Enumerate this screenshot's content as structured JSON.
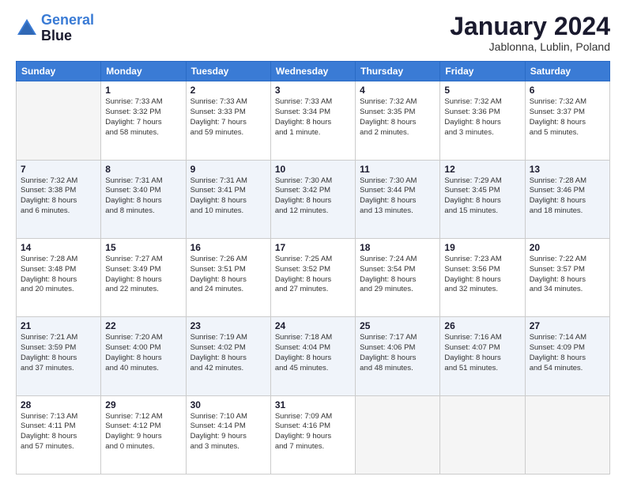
{
  "header": {
    "logo_line1": "General",
    "logo_line2": "Blue",
    "month": "January 2024",
    "location": "Jablonna, Lublin, Poland"
  },
  "weekdays": [
    "Sunday",
    "Monday",
    "Tuesday",
    "Wednesday",
    "Thursday",
    "Friday",
    "Saturday"
  ],
  "weeks": [
    [
      {
        "day": "",
        "info": ""
      },
      {
        "day": "1",
        "info": "Sunrise: 7:33 AM\nSunset: 3:32 PM\nDaylight: 7 hours\nand 58 minutes."
      },
      {
        "day": "2",
        "info": "Sunrise: 7:33 AM\nSunset: 3:33 PM\nDaylight: 7 hours\nand 59 minutes."
      },
      {
        "day": "3",
        "info": "Sunrise: 7:33 AM\nSunset: 3:34 PM\nDaylight: 8 hours\nand 1 minute."
      },
      {
        "day": "4",
        "info": "Sunrise: 7:32 AM\nSunset: 3:35 PM\nDaylight: 8 hours\nand 2 minutes."
      },
      {
        "day": "5",
        "info": "Sunrise: 7:32 AM\nSunset: 3:36 PM\nDaylight: 8 hours\nand 3 minutes."
      },
      {
        "day": "6",
        "info": "Sunrise: 7:32 AM\nSunset: 3:37 PM\nDaylight: 8 hours\nand 5 minutes."
      }
    ],
    [
      {
        "day": "7",
        "info": "Sunrise: 7:32 AM\nSunset: 3:38 PM\nDaylight: 8 hours\nand 6 minutes."
      },
      {
        "day": "8",
        "info": "Sunrise: 7:31 AM\nSunset: 3:40 PM\nDaylight: 8 hours\nand 8 minutes."
      },
      {
        "day": "9",
        "info": "Sunrise: 7:31 AM\nSunset: 3:41 PM\nDaylight: 8 hours\nand 10 minutes."
      },
      {
        "day": "10",
        "info": "Sunrise: 7:30 AM\nSunset: 3:42 PM\nDaylight: 8 hours\nand 12 minutes."
      },
      {
        "day": "11",
        "info": "Sunrise: 7:30 AM\nSunset: 3:44 PM\nDaylight: 8 hours\nand 13 minutes."
      },
      {
        "day": "12",
        "info": "Sunrise: 7:29 AM\nSunset: 3:45 PM\nDaylight: 8 hours\nand 15 minutes."
      },
      {
        "day": "13",
        "info": "Sunrise: 7:28 AM\nSunset: 3:46 PM\nDaylight: 8 hours\nand 18 minutes."
      }
    ],
    [
      {
        "day": "14",
        "info": "Sunrise: 7:28 AM\nSunset: 3:48 PM\nDaylight: 8 hours\nand 20 minutes."
      },
      {
        "day": "15",
        "info": "Sunrise: 7:27 AM\nSunset: 3:49 PM\nDaylight: 8 hours\nand 22 minutes."
      },
      {
        "day": "16",
        "info": "Sunrise: 7:26 AM\nSunset: 3:51 PM\nDaylight: 8 hours\nand 24 minutes."
      },
      {
        "day": "17",
        "info": "Sunrise: 7:25 AM\nSunset: 3:52 PM\nDaylight: 8 hours\nand 27 minutes."
      },
      {
        "day": "18",
        "info": "Sunrise: 7:24 AM\nSunset: 3:54 PM\nDaylight: 8 hours\nand 29 minutes."
      },
      {
        "day": "19",
        "info": "Sunrise: 7:23 AM\nSunset: 3:56 PM\nDaylight: 8 hours\nand 32 minutes."
      },
      {
        "day": "20",
        "info": "Sunrise: 7:22 AM\nSunset: 3:57 PM\nDaylight: 8 hours\nand 34 minutes."
      }
    ],
    [
      {
        "day": "21",
        "info": "Sunrise: 7:21 AM\nSunset: 3:59 PM\nDaylight: 8 hours\nand 37 minutes."
      },
      {
        "day": "22",
        "info": "Sunrise: 7:20 AM\nSunset: 4:00 PM\nDaylight: 8 hours\nand 40 minutes."
      },
      {
        "day": "23",
        "info": "Sunrise: 7:19 AM\nSunset: 4:02 PM\nDaylight: 8 hours\nand 42 minutes."
      },
      {
        "day": "24",
        "info": "Sunrise: 7:18 AM\nSunset: 4:04 PM\nDaylight: 8 hours\nand 45 minutes."
      },
      {
        "day": "25",
        "info": "Sunrise: 7:17 AM\nSunset: 4:06 PM\nDaylight: 8 hours\nand 48 minutes."
      },
      {
        "day": "26",
        "info": "Sunrise: 7:16 AM\nSunset: 4:07 PM\nDaylight: 8 hours\nand 51 minutes."
      },
      {
        "day": "27",
        "info": "Sunrise: 7:14 AM\nSunset: 4:09 PM\nDaylight: 8 hours\nand 54 minutes."
      }
    ],
    [
      {
        "day": "28",
        "info": "Sunrise: 7:13 AM\nSunset: 4:11 PM\nDaylight: 8 hours\nand 57 minutes."
      },
      {
        "day": "29",
        "info": "Sunrise: 7:12 AM\nSunset: 4:12 PM\nDaylight: 9 hours\nand 0 minutes."
      },
      {
        "day": "30",
        "info": "Sunrise: 7:10 AM\nSunset: 4:14 PM\nDaylight: 9 hours\nand 3 minutes."
      },
      {
        "day": "31",
        "info": "Sunrise: 7:09 AM\nSunset: 4:16 PM\nDaylight: 9 hours\nand 7 minutes."
      },
      {
        "day": "",
        "info": ""
      },
      {
        "day": "",
        "info": ""
      },
      {
        "day": "",
        "info": ""
      }
    ]
  ]
}
